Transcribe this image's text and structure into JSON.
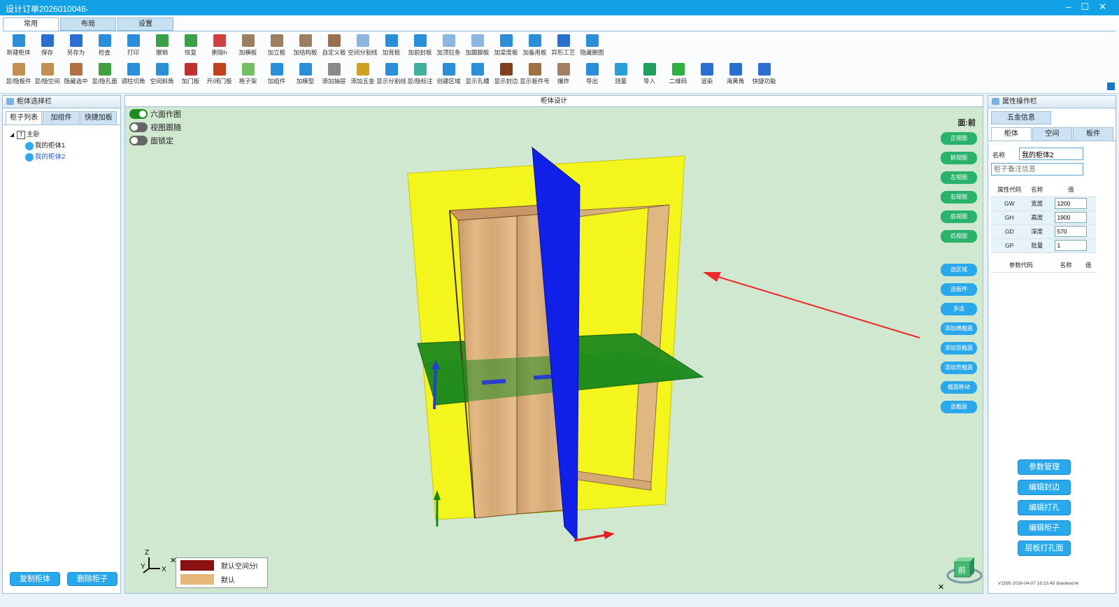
{
  "window": {
    "title": "设计订单2026010046-",
    "minimize": "–",
    "maximize": "☐",
    "close": "✕"
  },
  "ribbon": {
    "tabs": [
      "常用",
      "布局",
      "设置"
    ],
    "row1": [
      {
        "label": "新建柜体",
        "color": "#2a8fd8"
      },
      {
        "label": "保存",
        "color": "#2a6fd0"
      },
      {
        "label": "另存为",
        "color": "#2a6fd0"
      },
      {
        "label": "检查",
        "color": "#2a8fd8"
      },
      {
        "label": "打印",
        "color": "#2a8fd8"
      },
      {
        "label": "撤销",
        "color": "#3aa04a"
      },
      {
        "label": "恢复",
        "color": "#3aa04a"
      },
      {
        "label": "删除h",
        "color": "#d04040"
      },
      {
        "label": "加横板",
        "color": "#9a8060"
      },
      {
        "label": "加立板",
        "color": "#9a8060"
      },
      {
        "label": "加结构板",
        "color": "#9a8060"
      },
      {
        "label": "自定义板",
        "color": "#9a7050"
      },
      {
        "label": "空间分割线",
        "color": "#8ab6e0"
      },
      {
        "label": "加背板",
        "color": "#2a8fd8"
      },
      {
        "label": "加前封板",
        "color": "#2a8fd8"
      },
      {
        "label": "加顶拉条",
        "color": "#8ab6e0"
      },
      {
        "label": "加踢脚板",
        "color": "#8ab6e0"
      },
      {
        "label": "加梁度板",
        "color": "#2a8fd8"
      },
      {
        "label": "加备用板",
        "color": "#2a8fd8"
      },
      {
        "label": "异形工艺",
        "color": "#2a6fd0"
      },
      {
        "label": "隐藏删图",
        "color": "#2a8fd8"
      }
    ],
    "row2": [
      {
        "label": "显/隐板件",
        "color": "#c09050"
      },
      {
        "label": "显/隐空间",
        "color": "#c09050"
      },
      {
        "label": "隐藏选中",
        "color": "#b07040"
      },
      {
        "label": "显/隐孔面",
        "color": "#40a040"
      },
      {
        "label": "调柱切角",
        "color": "#2a8fd8"
      },
      {
        "label": "空间斜角",
        "color": "#2a8fd8"
      },
      {
        "label": "加门板",
        "color": "#c03030"
      },
      {
        "label": "开/闭门板",
        "color": "#c04020"
      },
      {
        "label": "格子架",
        "color": "#70c060"
      },
      {
        "label": "加组件",
        "color": "#2a8fd8"
      },
      {
        "label": "加模型",
        "color": "#2a8fd8"
      },
      {
        "label": "添加抽屉",
        "color": "#8a8a8a"
      },
      {
        "label": "添加五金",
        "color": "#d0a020"
      },
      {
        "label": "显示分割线",
        "color": "#2a8fd8"
      },
      {
        "label": "显/隐标注",
        "color": "#40b0a0"
      },
      {
        "label": "创建区域",
        "color": "#2a8fd8"
      },
      {
        "label": "显示孔槽",
        "color": "#2a8fd8"
      },
      {
        "label": "显示封边",
        "color": "#804020"
      },
      {
        "label": "显示板件号",
        "color": "#a07040"
      },
      {
        "label": "爆炸",
        "color": "#a08060"
      },
      {
        "label": "导出",
        "color": "#2a8fd8"
      },
      {
        "label": "测量",
        "color": "#2aa0d8"
      },
      {
        "label": "导入",
        "color": "#20a060"
      },
      {
        "label": "二维码",
        "color": "#30b040"
      },
      {
        "label": "渲染",
        "color": "#2a6fd0"
      },
      {
        "label": "海黄角",
        "color": "#2a6fd0"
      },
      {
        "label": "快捷功能",
        "color": "#2a6fd0"
      }
    ]
  },
  "left": {
    "header": "柜体选择栏",
    "tabs": [
      "柜子列表",
      "加组件",
      "快捷加板"
    ],
    "tree_root": "主卧",
    "items": [
      "我的柜体1",
      "我的柜体2"
    ],
    "copy_btn": "复制柜体",
    "delete_btn": "删除柜子"
  },
  "viewport": {
    "header": "柜体设计",
    "toggles": [
      {
        "label": "六面作图",
        "on": true
      },
      {
        "label": "视图跟随",
        "on": false
      },
      {
        "label": "面锁定",
        "on": false
      }
    ],
    "face": "面:前",
    "view_buttons": [
      "正视图",
      "俯视图",
      "左视图",
      "右视图",
      "底视图",
      "后视图"
    ],
    "action_buttons": [
      "选区域",
      "选板件",
      "多选",
      "添加横截面",
      "添加竖截面",
      "添加背截面",
      "截面移动",
      "选截面"
    ],
    "legend": [
      {
        "label": "默认空间分l",
        "color": "#8b1010"
      },
      {
        "label": "默认",
        "color": "#e8b77a"
      }
    ],
    "axis": {
      "z": "Z",
      "y": "Y",
      "x": "X"
    },
    "cube_label": "前",
    "close": "✕"
  },
  "right": {
    "header": "属性操作栏",
    "sub_tab": "五金信息",
    "tabs": [
      "柜体",
      "空间",
      "板件"
    ],
    "name_label": "名称",
    "name_value": "我的柜体2",
    "note_placeholder": "柜子备注信息",
    "table_head": [
      "属性代码",
      "名称",
      "值"
    ],
    "rows": [
      {
        "code": "GW",
        "name": "宽度",
        "value": "1200"
      },
      {
        "code": "GH",
        "name": "高度",
        "value": "1900"
      },
      {
        "code": "GD",
        "name": "深度",
        "value": "570"
      },
      {
        "code": "GP",
        "name": "批量",
        "value": "1"
      }
    ],
    "param_head": [
      "参数代码",
      "名称",
      "值"
    ],
    "buttons": [
      "参数管理",
      "编辑封边",
      "编辑打孔",
      "编辑柜子",
      "层板打孔面"
    ],
    "version": "V1595 2026-04-07 16:23:49 shaokexink"
  }
}
